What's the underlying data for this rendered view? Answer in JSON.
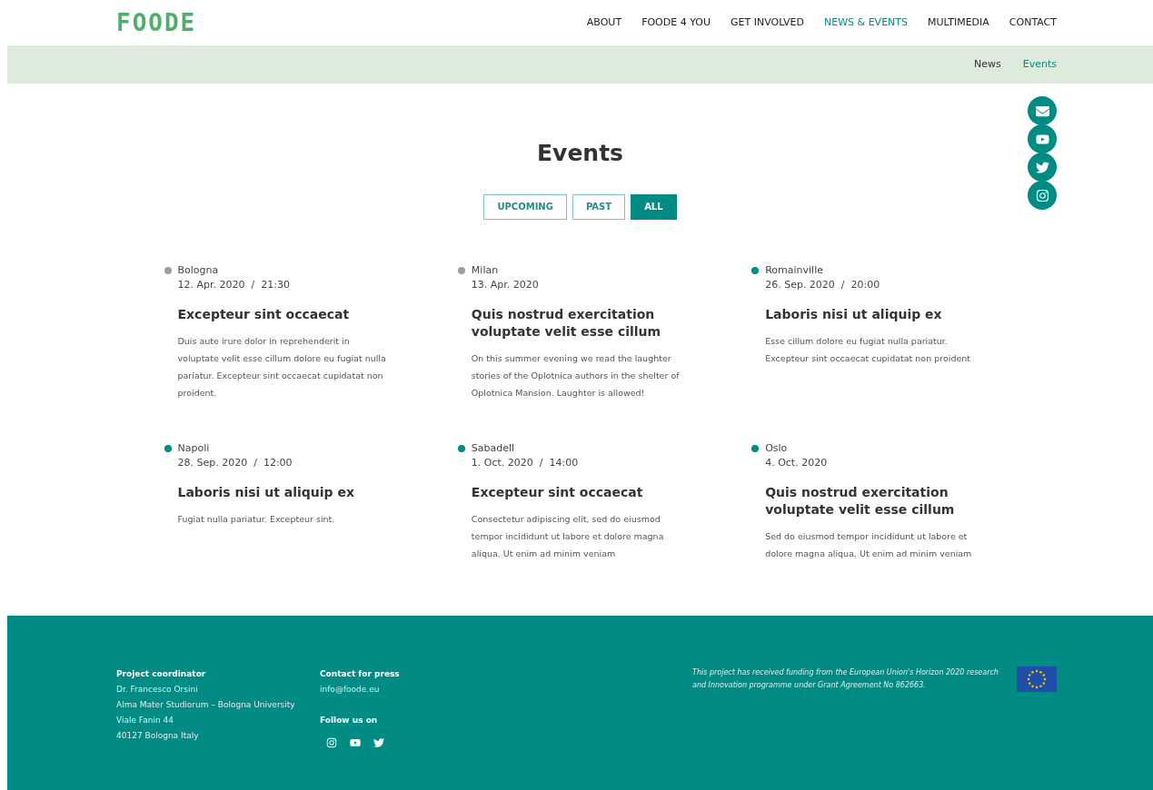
{
  "logo": "FOODE",
  "nav": [
    {
      "label": "ABOUT",
      "selected": false
    },
    {
      "label": "FOODE 4 YOU",
      "selected": false
    },
    {
      "label": "GET INVOLVED",
      "selected": false
    },
    {
      "label": "NEWS & EVENTS",
      "selected": true
    },
    {
      "label": "MULTIMEDIA",
      "selected": false
    },
    {
      "label": "CONTACT",
      "selected": false
    }
  ],
  "subnav": [
    {
      "label": "News",
      "selected": false
    },
    {
      "label": "Events",
      "selected": true
    }
  ],
  "title": "Events",
  "filters": [
    {
      "label": "UPCOMING",
      "selected": false
    },
    {
      "label": "PAST",
      "selected": false
    },
    {
      "label": "ALL",
      "selected": true
    }
  ],
  "events": [
    {
      "city": "Bologna",
      "date": "12. Apr. 2020  /  21:30",
      "title": "Excepteur sint occaecat",
      "text": "Duis aute irure dolor in reprehenderit in voluptate velit esse cillum dolore eu fugiat nulla pariatur. Excepteur sint occaecat cupidatat non proident.",
      "color": "#9e9e9e"
    },
    {
      "city": "Milan",
      "date": "13. Apr. 2020",
      "title": "Quis nostrud exercitation voluptate velit esse cillum",
      "text": "On this summer evening we read the laughter stories of the Oplotnica authors in the shelter of Oplotnica Mansion. Laughter is allowed!",
      "color": "#9e9e9e"
    },
    {
      "city": "Romainville",
      "date": "26. Sep. 2020  /  20:00",
      "title": "Laboris nisi ut aliquip ex",
      "text": "Esse cillum dolore eu fugiat nulla pariatur. Excepteur sint occaecat cupidatat non proident",
      "color": "#008c85"
    },
    {
      "city": "Napoli",
      "date": "28. Sep. 2020  /  12:00",
      "title": "Laboris nisi ut aliquip ex",
      "text": "Fugiat nulla pariatur. Excepteur sint.",
      "color": "#008c85"
    },
    {
      "city": "Sabadell",
      "date": "1. Oct. 2020  /  14:00",
      "title": "Excepteur sint occaecat",
      "text": "Consectetur adipiscing elit, sed do eiusmod tempor incididunt ut labore et dolore magna aliqua. Ut enim ad minim veniam",
      "color": "#008c85"
    },
    {
      "city": "Oslo",
      "date": "4. Oct. 2020",
      "title": "Quis nostrud exercitation voluptate velit esse cillum",
      "text": "Sed do eiusmod tempor incididunt ut labore et dolore magna aliqua. Ut enim ad minim veniam",
      "color": "#008c85"
    }
  ],
  "footer": {
    "coordinator": {
      "heading": "Project coordinator",
      "lines": [
        "Dr. Francesco Orsini",
        "Alma Mater Studiorum – Bologna University",
        "Viale Fanin 44",
        "40127 Bologna Italy"
      ]
    },
    "press": {
      "heading": "Contact for press",
      "email": "info@foode.eu"
    },
    "follow": {
      "heading": "Follow us on"
    },
    "funding": "This project has received funding from the European Union's Horizon 2020 research and Innovation programme under Grant Agreement No 862663."
  }
}
